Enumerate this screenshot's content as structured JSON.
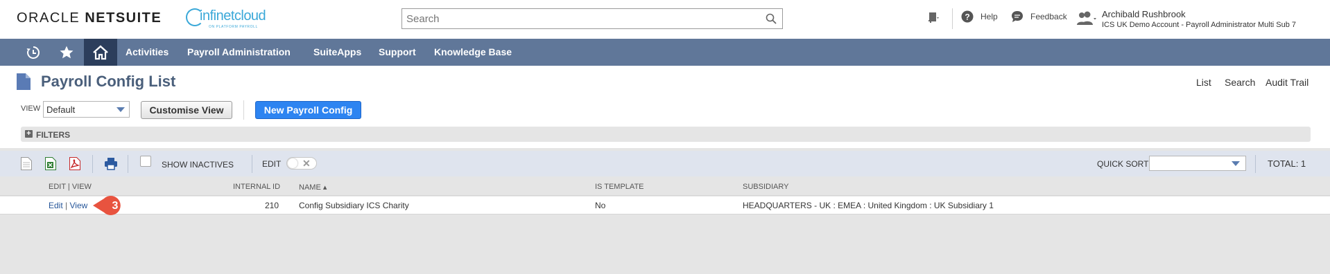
{
  "header": {
    "oracle_logo_light": "ORACLE ",
    "oracle_logo_bold": "NETSUITE",
    "partner_logo_name": "infinetcloud",
    "partner_logo_tag": "ON PLATFORM PAYROLL",
    "search_placeholder": "Search",
    "help_label": "Help",
    "feedback_label": "Feedback",
    "user_name": "Archibald Rushbrook",
    "user_role": "ICS UK Demo Account - Payroll Administrator Multi Sub 7"
  },
  "nav": {
    "items": [
      "Activities",
      "Payroll Administration",
      "SuiteApps",
      "Support",
      "Knowledge Base"
    ]
  },
  "page": {
    "title": "Payroll Config List",
    "top_links": [
      "List",
      "Search",
      "Audit Trail"
    ],
    "view_label": "VIEW",
    "view_value": "Default",
    "customise_button": "Customise View",
    "new_button": "New Payroll Config",
    "filters_label": "FILTERS"
  },
  "toolbar": {
    "show_inactives_label": "SHOW INACTIVES",
    "edit_label": "EDIT",
    "quick_sort_label": "QUICK SORT",
    "total_label": "TOTAL: 1"
  },
  "table": {
    "columns": [
      "EDIT | VIEW",
      "INTERNAL ID",
      "NAME ▴",
      "IS TEMPLATE",
      "SUBSIDIARY"
    ],
    "rows": [
      {
        "edit": "Edit",
        "sep": "|",
        "view": "View",
        "internal_id": "210",
        "name": "Config Subsidiary ICS Charity",
        "is_template": "No",
        "subsidiary": "HEADQUARTERS - UK : EMEA : United Kingdom : UK Subsidiary 1"
      }
    ]
  },
  "annotation": {
    "step_number": "3",
    "color": "#e8533f"
  }
}
